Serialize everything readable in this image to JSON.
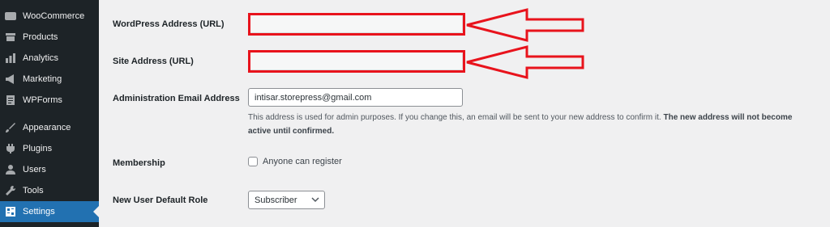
{
  "sidebar": {
    "items": [
      {
        "label": "WooCommerce",
        "icon": "woocommerce-icon"
      },
      {
        "label": "Products",
        "icon": "products-icon"
      },
      {
        "label": "Analytics",
        "icon": "analytics-icon"
      },
      {
        "label": "Marketing",
        "icon": "marketing-icon"
      },
      {
        "label": "WPForms",
        "icon": "wpforms-icon"
      },
      {
        "label": "Appearance",
        "icon": "appearance-icon"
      },
      {
        "label": "Plugins",
        "icon": "plugins-icon"
      },
      {
        "label": "Users",
        "icon": "users-icon"
      },
      {
        "label": "Tools",
        "icon": "tools-icon"
      },
      {
        "label": "Settings",
        "icon": "settings-icon",
        "active": true
      }
    ]
  },
  "form": {
    "wordpress_address": {
      "label": "WordPress Address (URL)",
      "value": ""
    },
    "site_address": {
      "label": "Site Address (URL)",
      "value": ""
    },
    "admin_email": {
      "label": "Administration Email Address",
      "value": "intisar.storepress@gmail.com",
      "description": "This address is used for admin purposes. If you change this, an email will be sent to your new address to confirm it.",
      "description_bold": "The new address will not become active until confirmed."
    },
    "membership": {
      "label": "Membership",
      "checkbox_label": "Anyone can register",
      "checked": false
    },
    "default_role": {
      "label": "New User Default Role",
      "selected": "Subscriber"
    }
  },
  "annotations": {
    "highlight_color": "#e8131c"
  },
  "colors": {
    "sidebar_bg": "#1d2327",
    "active_bg": "#2271b1",
    "content_bg": "#f0f0f1"
  }
}
